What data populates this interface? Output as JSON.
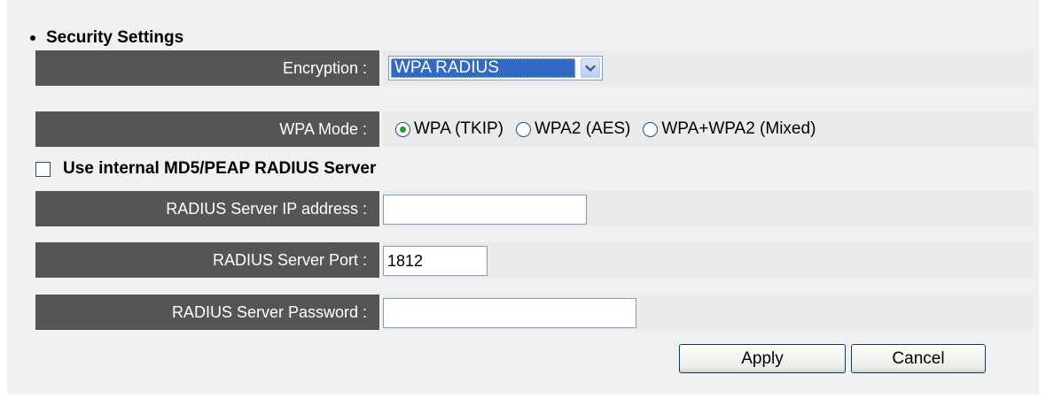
{
  "section": {
    "title": "Security Settings"
  },
  "encryption": {
    "label": "Encryption :",
    "selected": "WPA RADIUS"
  },
  "wpa_mode": {
    "label": "WPA Mode :",
    "options": [
      {
        "label": "WPA (TKIP)",
        "checked": true
      },
      {
        "label": "WPA2 (AES)",
        "checked": false
      },
      {
        "label": "WPA+WPA2 (Mixed)",
        "checked": false
      }
    ]
  },
  "internal_radius": {
    "label": "Use internal MD5/PEAP RADIUS Server",
    "checked": false
  },
  "radius_ip": {
    "label": "RADIUS Server IP address :",
    "value": ""
  },
  "radius_port": {
    "label": "RADIUS Server Port :",
    "value": "1812"
  },
  "radius_password": {
    "label": "RADIUS Server Password :",
    "value": ""
  },
  "buttons": {
    "apply": "Apply",
    "cancel": "Cancel"
  },
  "colors": {
    "label_bg": "#555555",
    "select_highlight": "#316ac5",
    "radio_dot": "#21a121"
  },
  "icons": {
    "section_bullet": "bullet-icon",
    "select_arrow": "chevron-down-icon"
  }
}
